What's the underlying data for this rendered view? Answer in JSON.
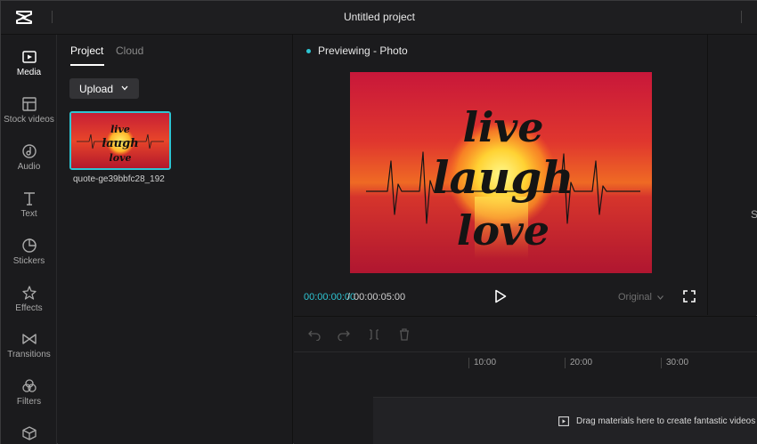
{
  "app": {
    "window_title": "Untitled project"
  },
  "nav": {
    "items": [
      {
        "label": "Media",
        "icon": "media-icon"
      },
      {
        "label": "Stock videos",
        "icon": "stock-videos-icon"
      },
      {
        "label": "Audio",
        "icon": "audio-icon"
      },
      {
        "label": "Text",
        "icon": "text-icon"
      },
      {
        "label": "Stickers",
        "icon": "stickers-icon"
      },
      {
        "label": "Effects",
        "icon": "effects-icon"
      },
      {
        "label": "Transitions",
        "icon": "transitions-icon"
      },
      {
        "label": "Filters",
        "icon": "filters-icon"
      },
      {
        "label": "",
        "icon": "cube-icon"
      }
    ]
  },
  "media": {
    "tabs": [
      {
        "label": "Project"
      },
      {
        "label": "Cloud"
      }
    ],
    "upload_label": "Upload",
    "items": [
      {
        "name": "quote-ge39bbfc28_192"
      }
    ]
  },
  "preview": {
    "label": "Previewing - Photo",
    "image_text": [
      "live",
      "laugh",
      "love"
    ],
    "time_current": "00:00:00:00",
    "time_separator": "/",
    "time_total": "00:00:05:00",
    "ratio_label": "Original",
    "accent": "#2ec5d3"
  },
  "right_panel": {
    "partial_text": "S"
  },
  "timeline": {
    "ticks": [
      "10:00",
      "20:00",
      "30:00"
    ],
    "drop_hint": "Drag materials here to create fantastic videos"
  }
}
